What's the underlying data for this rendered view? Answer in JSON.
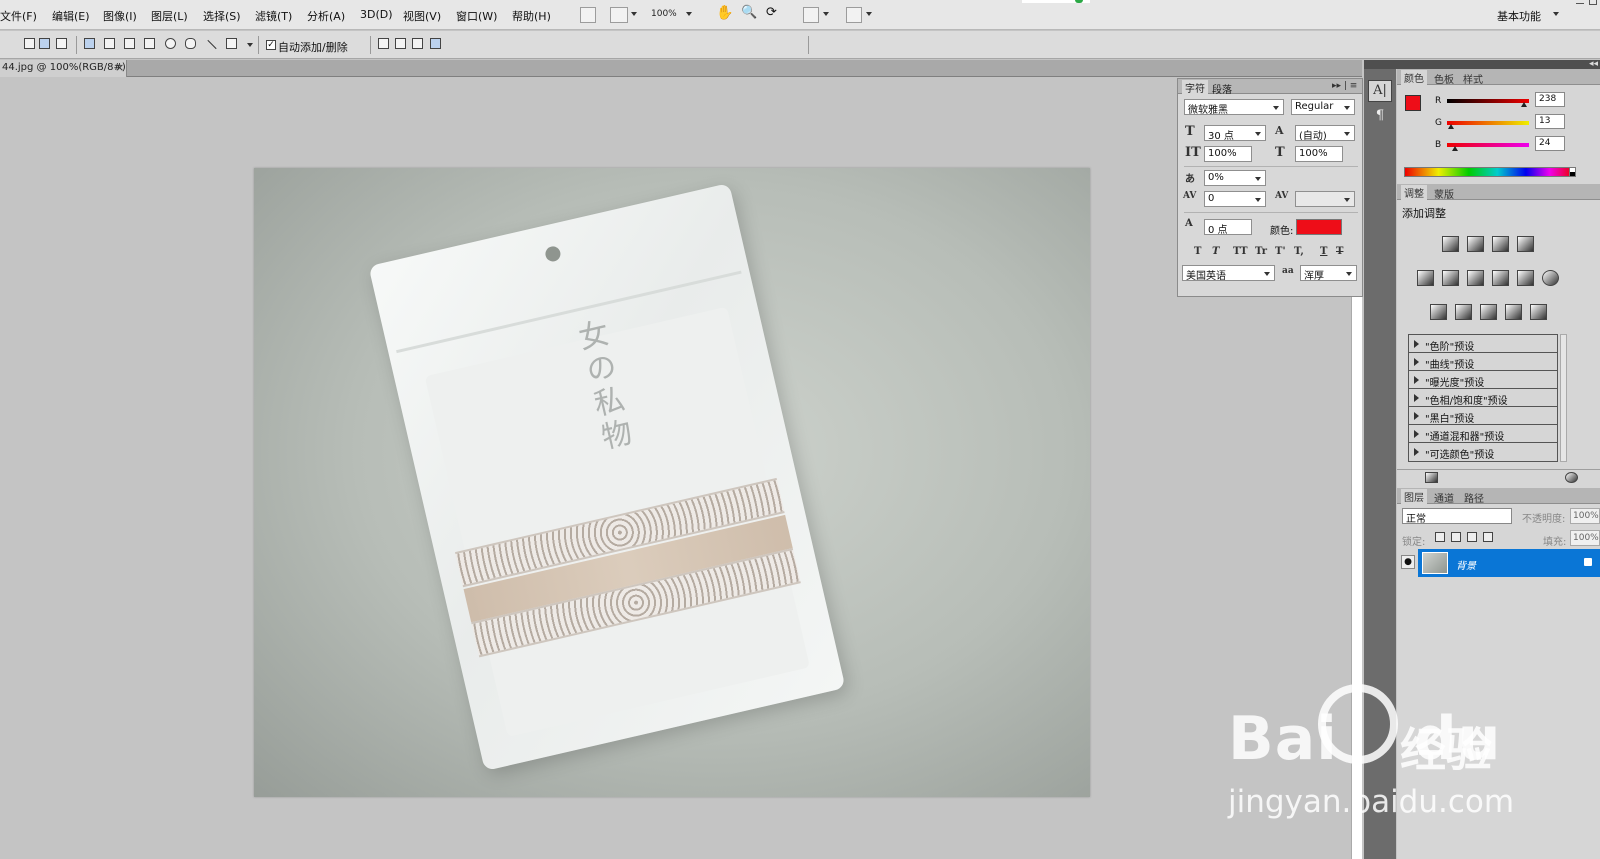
{
  "menubar": {
    "items": [
      "文件(F)",
      "编辑(E)",
      "图像(I)",
      "图层(L)",
      "选择(S)",
      "滤镜(T)",
      "分析(A)",
      "3D(D)",
      "视图(V)",
      "窗口(W)",
      "帮助(H)"
    ],
    "zoom": "100%",
    "workspace": "基本功能"
  },
  "options": {
    "auto_add_delete": "自动添加/删除",
    "auto_add_checked": true
  },
  "document": {
    "tab_title": "44.jpg @ 100%(RGB/8#)",
    "close": "×",
    "brand_text": "女の私物"
  },
  "character_panel": {
    "tab_character": "字符",
    "tab_paragraph": "段落",
    "font_family": "微软雅黑",
    "font_style": "Regular",
    "font_size": "30 点",
    "leading": "(自动)",
    "vertical_scale": "100%",
    "horizontal_scale": "100%",
    "tsume": "0%",
    "kerning": "0",
    "tracking": "",
    "baseline_shift": "0 点",
    "color_label": "颜色:",
    "color": "#ee0d18",
    "language": "美国英语",
    "antialias": "浑厚",
    "style_buttons": [
      "T",
      "T",
      "TT",
      "Tr",
      "T'",
      "T,",
      "T",
      "T"
    ]
  },
  "tool_strip": {
    "character_btn": "A|",
    "paragraph_btn": "¶"
  },
  "color_panel": {
    "tabs": [
      "颜色",
      "色板",
      "样式"
    ],
    "r_label": "R",
    "r": "238",
    "g_label": "G",
    "g": "13",
    "b_label": "B",
    "b": "24",
    "fg_color": "#ee0d18"
  },
  "adjustments_panel": {
    "tabs": [
      "调整",
      "蒙版"
    ],
    "title": "添加调整",
    "presets": [
      "\"色阶\"预设",
      "\"曲线\"预设",
      "\"曝光度\"预设",
      "\"色相/饱和度\"预设",
      "\"黑白\"预设",
      "\"通道混和器\"预设",
      "\"可选颜色\"预设"
    ]
  },
  "layers_panel": {
    "tabs": [
      "图层",
      "通道",
      "路径"
    ],
    "blend_mode": "正常",
    "opacity_label": "不透明度:",
    "opacity": "100%",
    "lock_label": "锁定:",
    "fill_label": "填充:",
    "fill": "100%",
    "layer_name": "背景"
  },
  "watermark": {
    "logo": "Bai",
    "logo2": "du",
    "jingyan": "经验",
    "url": "jingyan.baidu.com"
  }
}
